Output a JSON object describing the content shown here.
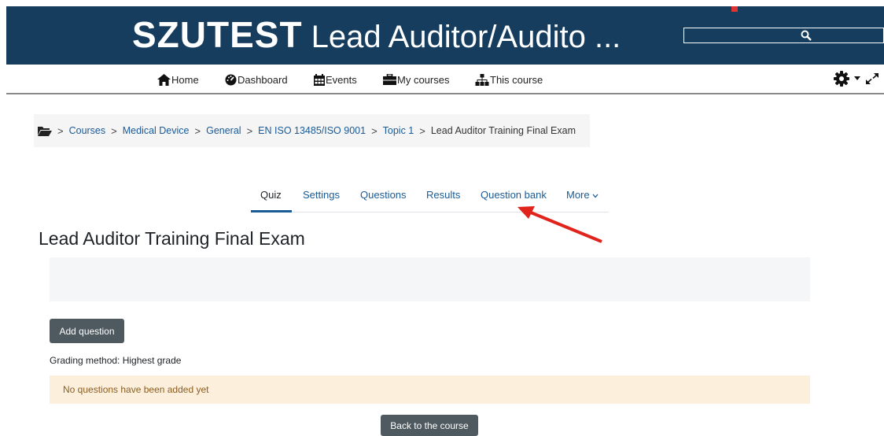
{
  "header": {
    "brand": "SZUTEST",
    "title_rest": " Lead Auditor/Audito ...",
    "search": {
      "placeholder": ""
    },
    "colors": {
      "banner": "#163c5e",
      "notification": "#dd3333"
    }
  },
  "nav": {
    "items": [
      {
        "icon": "home-icon",
        "label": "Home"
      },
      {
        "icon": "dashboard-icon",
        "label": "Dashboard"
      },
      {
        "icon": "calendar-icon",
        "label": "Events"
      },
      {
        "icon": "briefcase-icon",
        "label": "My courses"
      },
      {
        "icon": "sitemap-icon",
        "label": "This course"
      }
    ],
    "tools": [
      "gear-icon",
      "caret-down-icon",
      "expand-icon"
    ]
  },
  "breadcrumb": {
    "icon": "folder-open-icon",
    "items": [
      "Courses",
      "Medical Device",
      "General",
      "EN ISO 13485/ISO 9001",
      "Topic 1"
    ],
    "current": "Lead Auditor Training Final Exam"
  },
  "tabs": {
    "items": [
      "Quiz",
      "Settings",
      "Questions",
      "Results",
      "Question bank",
      "More"
    ],
    "active": "Quiz",
    "more_icon": "chevron-down-icon"
  },
  "annotation": {
    "icon": "red-arrow-icon",
    "color": "#e0241b"
  },
  "main": {
    "title": "Lead Auditor Training Final Exam",
    "add_question_label": "Add question",
    "grading_method": "Grading method: Highest grade",
    "notice": "No questions have been added yet",
    "back_label": "Back to the course"
  }
}
